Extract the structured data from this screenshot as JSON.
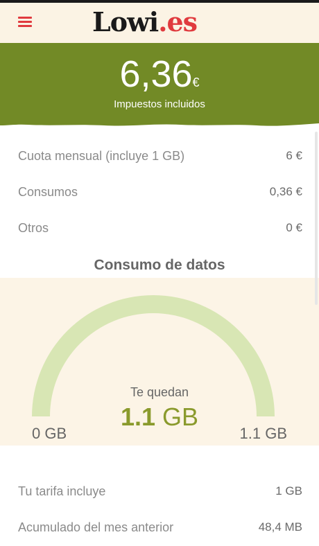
{
  "header": {
    "logo_part1": "Lowi",
    "logo_part2": ".es",
    "menu_icon": "hamburger-menu-icon",
    "accent_color": "#e03a3e"
  },
  "summary": {
    "amount": "6,36",
    "currency": "€",
    "tax_note": "Impuestos incluidos",
    "banner_color": "#728a26"
  },
  "breakdown": [
    {
      "label": "Cuota mensual (incluye 1 GB)",
      "value": "6 €"
    },
    {
      "label": "Consumos",
      "value": "0,36 €"
    },
    {
      "label": "Otros",
      "value": "0 €"
    }
  ],
  "data_usage": {
    "title": "Consumo de datos",
    "remaining_label": "Te quedan",
    "remaining_number": "1.1",
    "remaining_unit": "GB",
    "min_label": "0 GB",
    "max_label": "1.1 GB",
    "remaining_fraction": 1.0,
    "gauge_color": "#d8e6b4"
  },
  "plan_details": [
    {
      "label": "Tu tarifa incluye",
      "value": "1 GB"
    },
    {
      "label": "Acumulado del mes anterior",
      "value": "48,4 MB"
    }
  ]
}
